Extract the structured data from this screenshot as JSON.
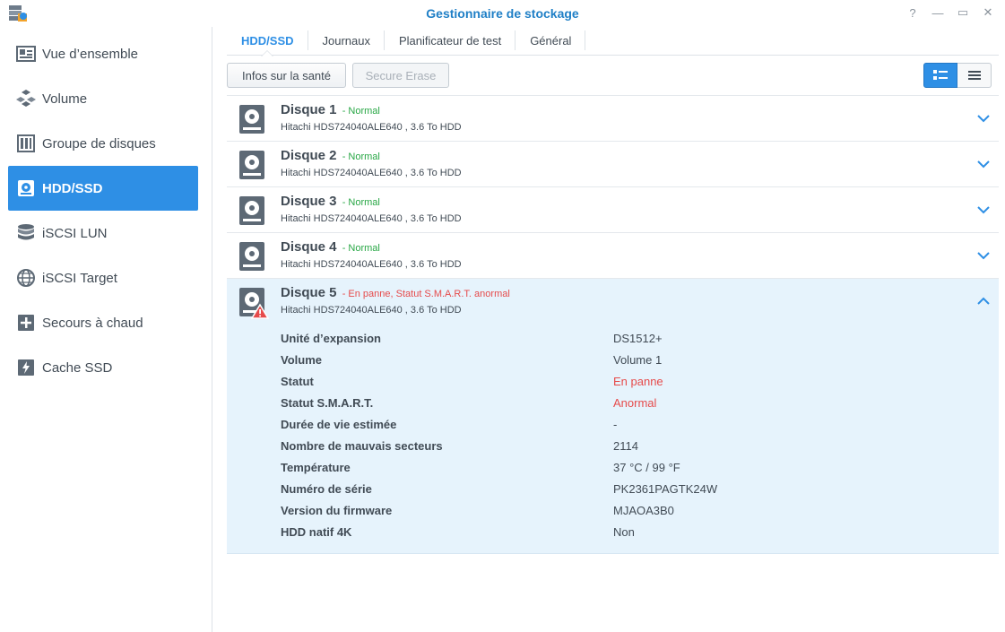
{
  "window": {
    "title": "Gestionnaire de stockage",
    "controls": {
      "help": "?",
      "minimize": "—",
      "maximize": "▭",
      "close": "✕"
    }
  },
  "sidebar": {
    "items": [
      {
        "label": "Vue d’ensemble",
        "icon": "overview-icon"
      },
      {
        "label": "Volume",
        "icon": "volume-icon"
      },
      {
        "label": "Groupe de disques",
        "icon": "disk-group-icon"
      },
      {
        "label": "HDD/SSD",
        "icon": "hdd-icon",
        "active": true
      },
      {
        "label": "iSCSI LUN",
        "icon": "iscsi-lun-icon"
      },
      {
        "label": "iSCSI Target",
        "icon": "globe-icon"
      },
      {
        "label": "Secours à chaud",
        "icon": "hot-spare-icon"
      },
      {
        "label": "Cache SSD",
        "icon": "ssd-cache-icon"
      }
    ]
  },
  "tabs": [
    {
      "label": "HDD/SSD",
      "active": true
    },
    {
      "label": "Journaux"
    },
    {
      "label": "Planificateur de test"
    },
    {
      "label": "Général"
    }
  ],
  "toolbar": {
    "health_label": "Infos sur la santé",
    "erase_label": "Secure Erase"
  },
  "disks": [
    {
      "name": "Disque 1",
      "status": "- Normal",
      "model": "Hitachi HDS724040ALE640 , 3.6 To HDD"
    },
    {
      "name": "Disque 2",
      "status": "- Normal",
      "model": "Hitachi HDS724040ALE640 , 3.6 To HDD"
    },
    {
      "name": "Disque 3",
      "status": "- Normal",
      "model": "Hitachi HDS724040ALE640 , 3.6 To HDD"
    },
    {
      "name": "Disque 4",
      "status": "- Normal",
      "model": "Hitachi HDS724040ALE640 , 3.6 To HDD"
    },
    {
      "name": "Disque 5",
      "status": "- En panne, Statut S.M.A.R.T. anormal",
      "model": "Hitachi HDS724040ALE640 , 3.6 To HDD"
    }
  ],
  "details": [
    {
      "key": "Unité d’expansion",
      "value": "DS1512+"
    },
    {
      "key": "Volume",
      "value": "Volume 1"
    },
    {
      "key": "Statut",
      "value": "En panne"
    },
    {
      "key": "Statut S.M.A.R.T.",
      "value": "Anormal"
    },
    {
      "key": "Durée de vie estimée",
      "value": "-"
    },
    {
      "key": "Nombre de mauvais secteurs",
      "value": "2114"
    },
    {
      "key": "Température",
      "value": "37 °C / 99 °F"
    },
    {
      "key": "Numéro de série",
      "value": "PK2361PAGTK24W"
    },
    {
      "key": "Version du firmware",
      "value": "MJAOA3B0"
    },
    {
      "key": "HDD natif 4K",
      "value": "Non"
    }
  ],
  "colors": {
    "accent": "#2e8fe5",
    "ok": "#28a745",
    "error": "#e64b4b",
    "title": "#1f7fc6"
  }
}
